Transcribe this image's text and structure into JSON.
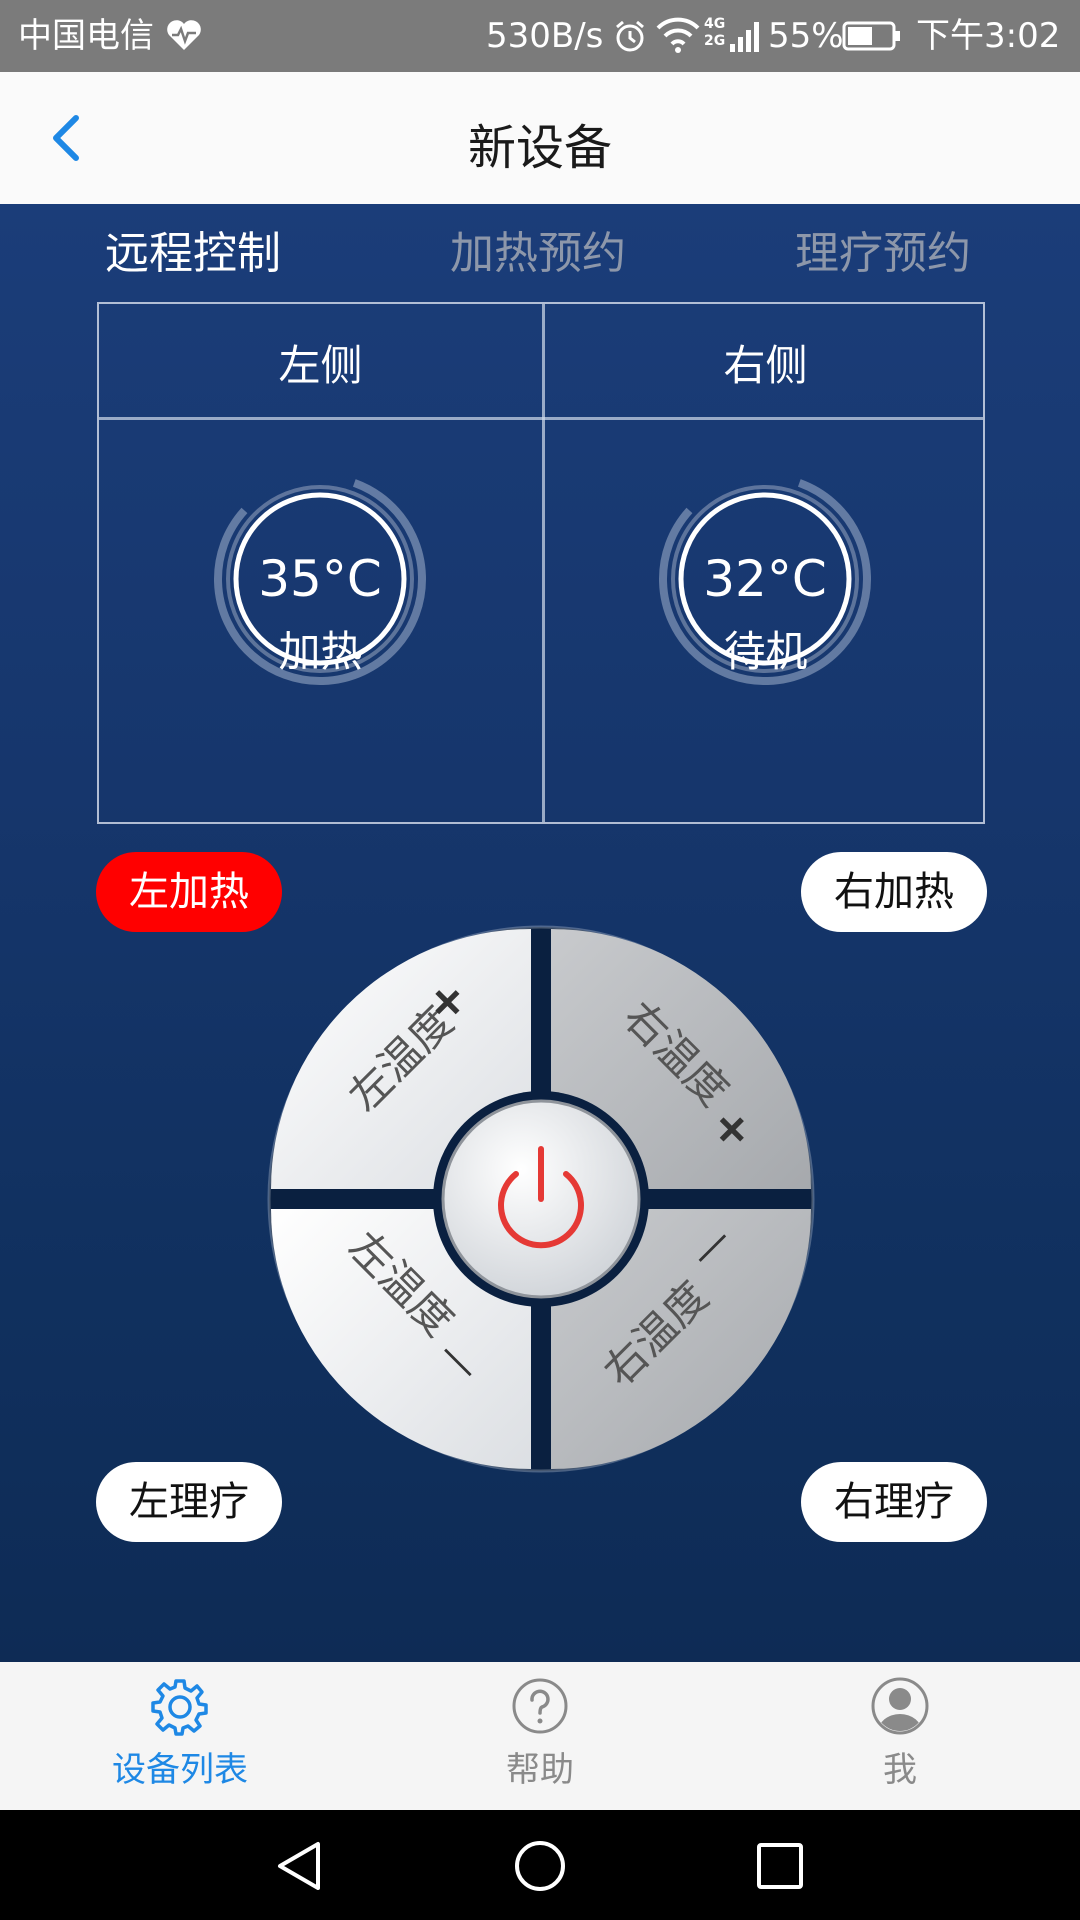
{
  "status_bar": {
    "carrier": "中国电信",
    "speed": "530B/s",
    "network": "4G 2G",
    "battery": "55%",
    "time": "下午3:02"
  },
  "header": {
    "title": "新设备"
  },
  "tabs": [
    {
      "label": "远程控制",
      "active": true
    },
    {
      "label": "加热预约",
      "active": false
    },
    {
      "label": "理疗预约",
      "active": false
    }
  ],
  "panel": {
    "left": {
      "label": "左侧",
      "temp": "35°C",
      "state": "加热"
    },
    "right": {
      "label": "右侧",
      "temp": "32°C",
      "state": "待机"
    }
  },
  "buttons": {
    "left_heat": "左加热",
    "right_heat": "右加热",
    "left_therapy": "左理疗",
    "right_therapy": "右理疗"
  },
  "dial": {
    "left_temp_plus": "左温度",
    "right_temp_plus": "右温度",
    "left_temp_minus": "左温度",
    "right_temp_minus": "右温度",
    "plus_sign": "+",
    "minus_sign": "—"
  },
  "bottom_nav": [
    {
      "label": "设备列表",
      "icon": "gear-icon",
      "active": true
    },
    {
      "label": "帮助",
      "icon": "help-icon",
      "active": false
    },
    {
      "label": "我",
      "icon": "user-icon",
      "active": false
    }
  ],
  "colors": {
    "accent_blue": "#1e88e5",
    "heat_red": "#ff0000",
    "power_red": "#e53935",
    "panel_blue": "#173a74"
  }
}
